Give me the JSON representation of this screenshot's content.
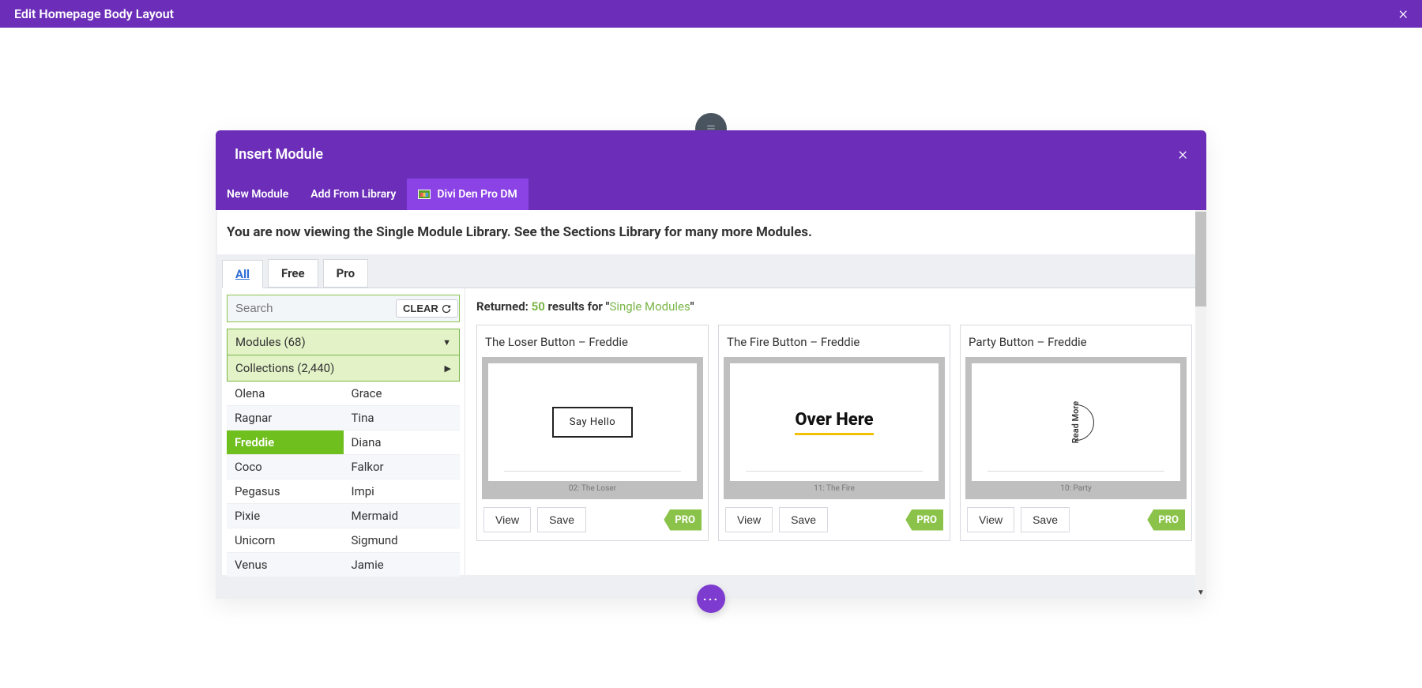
{
  "topbar": {
    "title": "Edit Homepage Body Layout"
  },
  "modal": {
    "title": "Insert Module",
    "tabs": {
      "new": "New Module",
      "library": "Add From Library",
      "divi": "Divi Den Pro DM"
    }
  },
  "banner": "You are now viewing the Single Module Library. See the Sections Library for many more Modules.",
  "filterTabs": {
    "all": "All",
    "free": "Free",
    "pro": "Pro"
  },
  "search": {
    "placeholder": "Search",
    "clear": "CLEAR"
  },
  "dropdowns": {
    "modules": "Modules (68)",
    "collections": "Collections (2,440)"
  },
  "collections": {
    "rows": [
      {
        "a": "Olena",
        "b": "Grace"
      },
      {
        "a": "Ragnar",
        "b": "Tina"
      },
      {
        "a": "Freddie",
        "b": "Diana"
      },
      {
        "a": "Coco",
        "b": "Falkor"
      },
      {
        "a": "Pegasus",
        "b": "Impi"
      },
      {
        "a": "Pixie",
        "b": "Mermaid"
      },
      {
        "a": "Unicorn",
        "b": "Sigmund"
      },
      {
        "a": "Venus",
        "b": "Jamie"
      }
    ]
  },
  "returned": {
    "label": "Returned:",
    "count": "50",
    "mid": "results for",
    "name": "Single Modules",
    "q": "\""
  },
  "cards": [
    {
      "title": "The Loser Button – Freddie",
      "previewText": "Say Hello",
      "caption": "02: The Loser",
      "view": "View",
      "save": "Save",
      "badge": "PRO"
    },
    {
      "title": "The Fire Button – Freddie",
      "previewText": "Over Here",
      "caption": "11: The Fire",
      "view": "View",
      "save": "Save",
      "badge": "PRO"
    },
    {
      "title": "Party Button – Freddie",
      "previewText": "Read More",
      "caption": "10: Party",
      "view": "View",
      "save": "Save",
      "badge": "PRO"
    }
  ]
}
